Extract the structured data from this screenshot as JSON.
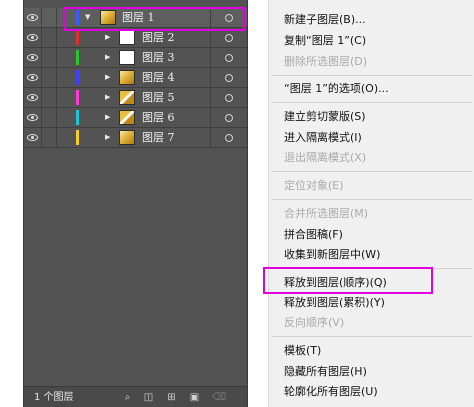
{
  "layers_panel": {
    "layers": [
      {
        "name": "图层 1",
        "color": "#3a5cff",
        "thumb": "gold",
        "selected": true,
        "expanded": true
      },
      {
        "name": "图层 2",
        "color": "#e03030",
        "thumb": "white",
        "selected": false,
        "expanded": false
      },
      {
        "name": "图层 3",
        "color": "#28c828",
        "thumb": "white",
        "selected": false,
        "expanded": false
      },
      {
        "name": "图层 4",
        "color": "#4040ff",
        "thumb": "gold",
        "selected": false,
        "expanded": false
      },
      {
        "name": "图层 5",
        "color": "#ff3ad8",
        "thumb": "gold-stripe",
        "selected": false,
        "expanded": false
      },
      {
        "name": "图层 6",
        "color": "#18c8d8",
        "thumb": "gold-stripe",
        "selected": false,
        "expanded": false
      },
      {
        "name": "图层 7",
        "color": "#f0d020",
        "thumb": "gold",
        "selected": false,
        "expanded": false
      }
    ],
    "footer": {
      "layer_count": "1 个图层",
      "icons": [
        "search-icon",
        "make-clipping-mask-icon",
        "create-sublayer-icon",
        "new-layer-icon",
        "delete-icon"
      ]
    }
  },
  "context_menu": {
    "items": [
      {
        "label": "新建子图层(B)...",
        "enabled": true
      },
      {
        "label": "复制“图层 1”(C)",
        "enabled": true
      },
      {
        "label": "删除所选图层(D)",
        "enabled": false
      },
      {
        "label": "“图层 1”的选项(O)...",
        "enabled": true
      },
      {
        "label": "建立剪切蒙版(S)",
        "enabled": true
      },
      {
        "label": "进入隔离模式(I)",
        "enabled": true
      },
      {
        "label": "退出隔离模式(X)",
        "enabled": false
      },
      {
        "label": "定位对象(E)",
        "enabled": false
      },
      {
        "label": "合并所选图层(M)",
        "enabled": false
      },
      {
        "label": "拼合图稿(F)",
        "enabled": true
      },
      {
        "label": "收集到新图层中(W)",
        "enabled": true
      },
      {
        "label": "释放到图层(顺序)(Q)",
        "enabled": true,
        "highlighted": true
      },
      {
        "label": "释放到图层(累积)(Y)",
        "enabled": true
      },
      {
        "label": "反向顺序(V)",
        "enabled": false
      },
      {
        "label": "模板(T)",
        "enabled": true
      },
      {
        "label": "隐藏所有图层(H)",
        "enabled": true
      },
      {
        "label": "轮廓化所有图层(U)",
        "enabled": true
      }
    ]
  },
  "colors": {
    "panel_bg": "#535353",
    "menu_bg": "#f0f0f0",
    "annotation": "#e000e0"
  }
}
